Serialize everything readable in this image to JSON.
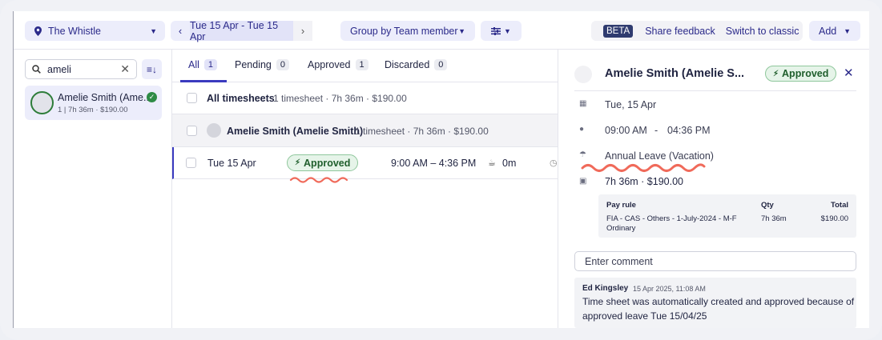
{
  "toolbar": {
    "location": "The Whistle",
    "date_range": "Tue 15 Apr - Tue 15 Apr",
    "group_by": "Group by Team member",
    "beta": "BETA",
    "share_feedback": "Share feedback",
    "switch_classic": "Switch to classic",
    "add": "Add"
  },
  "left": {
    "search_value": "ameli",
    "person": {
      "name": "Amelie Smith (Ame...",
      "sub": "1 | 7h 36m · $190.00"
    }
  },
  "tabs": [
    {
      "label": "All",
      "count": "1"
    },
    {
      "label": "Pending",
      "count": "0"
    },
    {
      "label": "Approved",
      "count": "1"
    },
    {
      "label": "Discarded",
      "count": "0"
    }
  ],
  "rows": {
    "all": {
      "title": "All timesheets",
      "summary": "1 timesheet · 7h 36m · $190.00"
    },
    "group": {
      "title": "Amelie Smith (Amelie Smith)",
      "summary": "1 timesheet · 7h 36m · $190.00"
    },
    "entry": {
      "date": "Tue 15 Apr",
      "status": "Approved",
      "time": "9:00 AM – 4:36 PM",
      "break": "0m"
    }
  },
  "detail": {
    "name": "Amelie Smith (Amelie S...",
    "status": "Approved",
    "date": "Tue, 15 Apr",
    "start": "09:00 AM",
    "sep": "-",
    "end": "04:36 PM",
    "leave": "Annual Leave (Vacation)",
    "total": "7h 36m  · $190.00",
    "pay_table": {
      "headers": {
        "rule": "Pay rule",
        "qty": "Qty",
        "total": "Total"
      },
      "rule_line1": "FIA - CAS - Others - 1-July-2024 - M-F",
      "rule_line2": "Ordinary",
      "qty": "7h 36m",
      "total": "$190.00"
    },
    "comment_placeholder": "Enter comment",
    "note": {
      "author": "Ed Kingsley",
      "timestamp": "15 Apr 2025, 11:08 AM",
      "text_line1": "Time sheet was automatically created and approved because of",
      "text_line2": "approved leave Tue 15/04/25"
    }
  },
  "colors": {
    "accent": "#2b2a8a",
    "approved_green": "#2e8b45",
    "annotation_red": "#f06a5a"
  }
}
